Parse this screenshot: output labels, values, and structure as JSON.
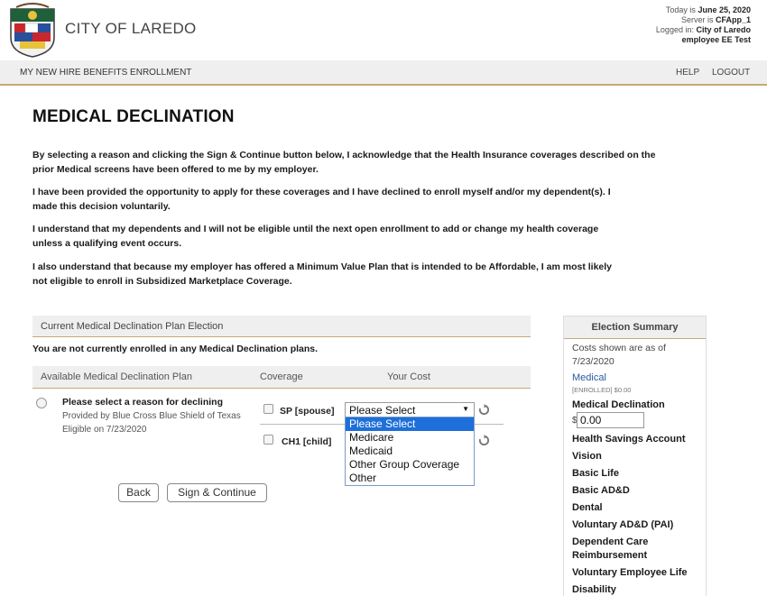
{
  "header": {
    "city_name": "CITY OF LAREDO",
    "today_label": "Today is",
    "today_value": "June 25, 2020",
    "server_label": "Server is",
    "server_value": "CFApp_1",
    "logged_label": "Logged in:",
    "logged_value": "City of Laredo",
    "user": "employee EE Test"
  },
  "nav": {
    "title": "MY NEW HIRE BENEFITS ENROLLMENT",
    "help": "HELP",
    "logout": "LOGOUT"
  },
  "page": {
    "title": "MEDICAL DECLINATION",
    "paragraphs": [
      [
        "By selecting a reason and clicking the Sign & Continue button below, I acknowledge that the Health Insurance coverages described on the",
        "prior Medical screens have been offered to me by my employer."
      ],
      [
        "I have been provided the opportunity to apply for these coverages and I have declined to enroll myself and/or my dependent(s). I",
        "made this decision voluntarily."
      ],
      [
        "I understand that my dependents and I will not be eligible until the next open enrollment to add or change my health coverage",
        "unless a qualifying event occurs."
      ],
      [
        "I also understand that because my employer has offered a Minimum Value Plan that is intended to be Affordable, I am most likely",
        "not eligible to enroll in Subsidized Marketplace Coverage."
      ]
    ]
  },
  "election": {
    "section_title": "Current Medical Declination Plan Election",
    "not_enrolled": "You are not currently enrolled in any Medical Declination plans.",
    "columns": {
      "plan": "Available Medical Declination Plan",
      "coverage": "Coverage",
      "cost": "Your Cost"
    },
    "plan": {
      "name": "Please select a reason for declining",
      "provider": "Provided by Blue Cross Blue Shield of Texas",
      "eligible": "Eligible on 7/23/2020"
    },
    "coverages": [
      "SP [spouse]",
      "CH1 [child]"
    ],
    "select_value": "Please Select",
    "options": [
      "Please Select",
      "Medicare",
      "Medicaid",
      "Other Group Coverage",
      "Other"
    ]
  },
  "buttons": {
    "back": "Back",
    "sign_continue": "Sign & Continue"
  },
  "summary": {
    "title": "Election Summary",
    "costs_as_of": "Costs shown are as of 7/23/2020",
    "medical": "Medical",
    "enrolled": "[ENROLLED] $0.00",
    "declination": "Medical Declination",
    "currency": "$",
    "amount": "0.00",
    "items": [
      "Health Savings Account",
      "Vision",
      "Basic Life",
      "Basic AD&D",
      "Dental",
      "Voluntary AD&D (PAI)",
      "Dependent Care Reimbursement",
      "Voluntary Employee Life",
      "Disability"
    ]
  },
  "colors": {
    "accent_rule": "#c8a879",
    "header_bg": "#efefef",
    "select_highlight": "#1e6fd9",
    "link": "#2a5aa0"
  }
}
